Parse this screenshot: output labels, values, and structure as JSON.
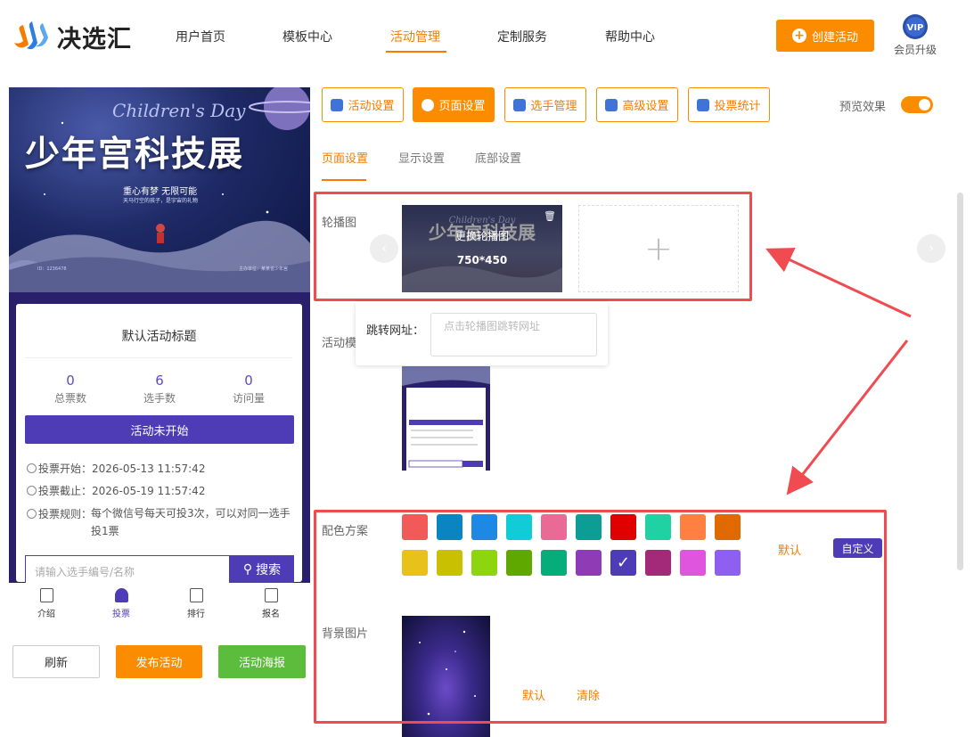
{
  "header": {
    "brand": "决选汇",
    "nav": [
      "用户首页",
      "模板中心",
      "活动管理",
      "定制服务",
      "帮助中心"
    ],
    "active_nav": "活动管理",
    "create_button": "创建活动",
    "vip_badge": "VIP",
    "vip_label": "会员升级"
  },
  "preview": {
    "poster": {
      "english_title": "Children's Day",
      "title": "少年宫科技展",
      "subtitle": "重心有梦 无限可能",
      "subtitle_small": "天马行空的孩子，是宇宙的礼物",
      "footer_left": "ID：1236478",
      "footer_right": "主办单位：某某省少年宫"
    },
    "card": {
      "title": "默认活动标题",
      "stats": [
        {
          "value": "0",
          "label": "总票数"
        },
        {
          "value": "6",
          "label": "选手数"
        },
        {
          "value": "0",
          "label": "访问量"
        }
      ],
      "status_button": "活动未开始",
      "vote_start": "投票开始：2026-05-13 11:57:42",
      "vote_end": "投票截止：2026-05-19 11:57:42",
      "vote_rule_label": "投票规则：",
      "vote_rule": "每个微信号每天可投3次，可以对同一选手投1票",
      "search_placeholder": "请输入选手编号/名称",
      "search_button": "搜索"
    },
    "tabbar": [
      {
        "label": "介绍",
        "icon": "doc-icon"
      },
      {
        "label": "投票",
        "icon": "person-icon"
      },
      {
        "label": "排行",
        "icon": "bar-chart-icon"
      },
      {
        "label": "报名",
        "icon": "badge-icon"
      }
    ],
    "active_tab": "投票",
    "buttons": {
      "refresh": "刷新",
      "publish": "发布活动",
      "poster": "活动海报"
    }
  },
  "settings": {
    "tabs": [
      {
        "label": "活动设置",
        "icon": "star-icon"
      },
      {
        "label": "页面设置",
        "icon": "gear-icon"
      },
      {
        "label": "选手管理",
        "icon": "users-icon"
      },
      {
        "label": "高级设置",
        "icon": "sliders-icon"
      },
      {
        "label": "投票统计",
        "icon": "chart-icon"
      }
    ],
    "active_tab": "页面设置",
    "preview_toggle_label": "预览效果",
    "preview_toggle_on": true,
    "subtabs": [
      "页面设置",
      "显示设置",
      "底部设置"
    ],
    "active_subtab": "页面设置",
    "carousel": {
      "label": "轮播图",
      "change_text": "更换轮播图",
      "size_text": "750*450",
      "add_symbol": "+",
      "link_label": "跳转网址：",
      "link_placeholder": "点击轮播图跳转网址"
    },
    "template_label": "活动模",
    "color_scheme": {
      "label": "配色方案",
      "swatches": [
        "#f25a5a",
        "#0a85c2",
        "#1e88e5",
        "#11ccd6",
        "#e86a95",
        "#0c9e94",
        "#e00000",
        "#1fd1a3",
        "#ff8040",
        "#e06a00",
        "#e8c21a",
        "#c8c000",
        "#8cd50f",
        "#5ea800",
        "#06ad7a",
        "#8e3cb6",
        "#4e3cb6",
        "#a32a78",
        "#e055de",
        "#8e5ff0"
      ],
      "selected_index": 16,
      "default_link": "默认",
      "custom_button": "自定义"
    },
    "background": {
      "label": "背景图片",
      "default_link": "默认",
      "clear_link": "清除"
    }
  },
  "colors": {
    "accent": "#fb8c00",
    "theme": "#4e3cb6",
    "annotation_red": "#ef4b50"
  }
}
